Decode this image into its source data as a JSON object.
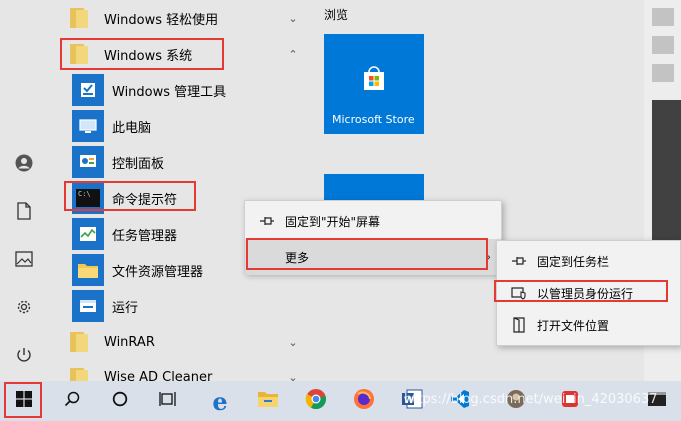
{
  "applist": {
    "groups": [
      {
        "label": "Windows 轻松使用",
        "chevron": "chevron-down-icon"
      },
      {
        "label": "Windows 系统",
        "chevron": "chevron-up-icon"
      }
    ],
    "children": [
      {
        "label": "Windows 管理工具"
      },
      {
        "label": "此电脑"
      },
      {
        "label": "控制面板"
      },
      {
        "label": "命令提示符"
      },
      {
        "label": "任务管理器"
      },
      {
        "label": "文件资源管理器"
      },
      {
        "label": "运行"
      }
    ],
    "groups_after": [
      {
        "label": "WinRAR",
        "chevron": "chevron-down-icon"
      },
      {
        "label": "Wise AD Cleaner",
        "chevron": "chevron-down-icon"
      }
    ]
  },
  "tiles": {
    "section_title": "浏览",
    "store_label": "Microsoft Store"
  },
  "context_menu": {
    "items": [
      {
        "label": "固定到\"开始\"屏幕",
        "icon": "pin-icon"
      },
      {
        "label": "更多",
        "icon": ""
      }
    ]
  },
  "submenu": {
    "items": [
      {
        "label": "固定到任务栏",
        "icon": "pin-icon"
      },
      {
        "label": "以管理员身份运行",
        "icon": "run-as-admin-icon"
      },
      {
        "label": "打开文件位置",
        "icon": "open-folder-icon"
      }
    ]
  },
  "taskbar": {
    "watermark": "https://blog.csdn.net/weixin_42030637"
  },
  "colors": {
    "accent": "#0078d7",
    "highlight": "#e53935"
  }
}
